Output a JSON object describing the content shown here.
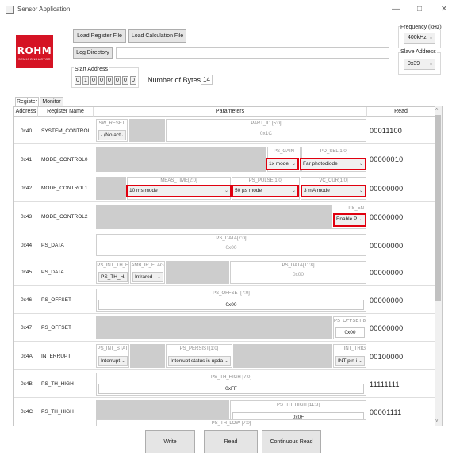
{
  "window": {
    "title": "Sensor Application",
    "minimize": "—",
    "maximize": "□",
    "close": "✕"
  },
  "logo": {
    "brand": "ROHM",
    "sub": "SEMICONDUCTOR"
  },
  "toolbar": {
    "load_register_file": "Load Register File",
    "load_calculation_file": "Load Calculation File",
    "log_directory": "Log Directory",
    "log_directory_value": ""
  },
  "start_address": {
    "label": "Start Address",
    "bits": [
      "0",
      "1",
      "0",
      "0",
      "0",
      "0",
      "0",
      "0"
    ]
  },
  "bytes": {
    "label": "Number of Bytes:",
    "value": "14"
  },
  "frequency": {
    "label": "Frequency (kHz)",
    "value": "400kHz"
  },
  "slave": {
    "label": "Slave Address",
    "value": "0x39"
  },
  "tabs": [
    {
      "label": "Register"
    },
    {
      "label": "Monitor"
    }
  ],
  "grid_headers": {
    "address": "Address",
    "register_name": "Register Name",
    "parameters": "Parameters",
    "read": "Read"
  },
  "rows": [
    {
      "addr": "0x40",
      "name": "SYSTEM_CONTROL",
      "read": "00011100",
      "f": {
        "sw_reset": "SW_RESET",
        "sw_reset_sel": "- (No act",
        "part_id": "PART_ID [5:0]",
        "part_id_val": "0x1C"
      }
    },
    {
      "addr": "0x41",
      "name": "MODE_CONTROL0",
      "read": "00000010",
      "f": {
        "ps_gain": "PS_GAIN",
        "ps_gain_sel": "1x mode",
        "pd_sel": "PD_SEL[1:0]",
        "pd_sel_sel": "Far photodiode"
      }
    },
    {
      "addr": "0x42",
      "name": "MODE_CONTROL1",
      "read": "00000000",
      "f": {
        "meas": "MEAS_TIME[2:0]",
        "meas_sel": "10 ms mode",
        "pulse": "PS_PULSE[1:0]",
        "pulse_sel": "50 µs mode",
        "vc": "VC_CUR[1:0]",
        "vc_sel": "3 mA mode"
      }
    },
    {
      "addr": "0x43",
      "name": "MODE_CONTROL2",
      "read": "00000000",
      "f": {
        "ps_en": "PS_EN",
        "ps_en_sel": "Enable P"
      }
    },
    {
      "addr": "0x44",
      "name": "PS_DATA",
      "read": "00000000",
      "f": {
        "label": "PS_DATA[7:0]",
        "val": "0x00"
      }
    },
    {
      "addr": "0x45",
      "name": "PS_DATA",
      "read": "00000000",
      "f": {
        "int_th": "PS_INT_TH_F",
        "int_th_sel": "PS_TH_H",
        "amb": "AMB_IR_FLAG",
        "amb_sel": "Infrared",
        "label": "PS_DATA[11:8]",
        "val": "0x00"
      }
    },
    {
      "addr": "0x46",
      "name": "PS_OFFSET",
      "read": "00000000",
      "f": {
        "label": "PS_OFFSET[7:0]",
        "val": "0x00"
      }
    },
    {
      "addr": "0x47",
      "name": "PS_OFFSET",
      "read": "00000000",
      "f": {
        "label": "PS_OFFSET[8]",
        "val": "0x00"
      }
    },
    {
      "addr": "0x4A",
      "name": "INTERRUPT",
      "read": "00100000",
      "f": {
        "int_stat": "PS_INT_STAT",
        "int_stat_sel": "Interrupt",
        "persist": "PS_PERSIST[1:0]",
        "persist_sel": "Interrupt status is upda",
        "int_trig": "INT_TRIG",
        "int_trig_sel": "INT pin i"
      }
    },
    {
      "addr": "0x4B",
      "name": "PS_TH_HIGH",
      "read": "11111111",
      "f": {
        "label": "PS_TH_HIGH [7:0]",
        "val": "0xFF"
      }
    },
    {
      "addr": "0x4C",
      "name": "PS_TH_HIGH",
      "read": "00001111",
      "f": {
        "label": "PS_TH_HIGH [11:8]",
        "val": "0x0F"
      }
    },
    {
      "addr": "",
      "name": "",
      "read": "",
      "f": {
        "label": "PS_TH_LOW [7:0]"
      }
    }
  ],
  "bottom": {
    "write": "Write",
    "read": "Read",
    "continuous_read": "Continuous Read"
  },
  "colors": {
    "highlight": "#e0000f",
    "logo": "#d51324"
  }
}
